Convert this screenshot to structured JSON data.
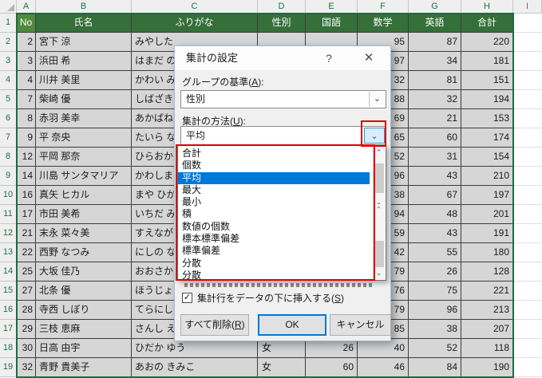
{
  "icons": {
    "help": "?",
    "close": "✕",
    "check": "✓",
    "combo_arrow": "⌄",
    "scroll_up": "⌃",
    "scroll_down": "⌄"
  },
  "colors": {
    "header_green": "#356f39",
    "selection_green": "#1d6b40",
    "annotation_red": "#e10000",
    "selected_item_blue": "#0078d7"
  },
  "spreadsheet": {
    "column_letters": [
      "A",
      "B",
      "C",
      "D",
      "E",
      "F",
      "G",
      "H",
      "I"
    ],
    "header": {
      "row_num": "1",
      "cells": [
        "No",
        "氏名",
        "ふりがな",
        "性別",
        "国語",
        "数学",
        "英語",
        "合計"
      ]
    },
    "rows": [
      {
        "row_num": "2",
        "cells": [
          "2",
          "宮下 涼",
          "みやした",
          "",
          "",
          "95",
          "87",
          "220"
        ]
      },
      {
        "row_num": "3",
        "cells": [
          "3",
          "浜田 希",
          "はまだ の",
          "",
          "",
          "97",
          "34",
          "181"
        ]
      },
      {
        "row_num": "4",
        "cells": [
          "4",
          "川井 美里",
          "かわい み",
          "",
          "",
          "32",
          "81",
          "151"
        ]
      },
      {
        "row_num": "5",
        "cells": [
          "7",
          "柴崎 優",
          "しばざき",
          "",
          "",
          "88",
          "32",
          "194"
        ]
      },
      {
        "row_num": "6",
        "cells": [
          "8",
          "赤羽 美幸",
          "あかばね",
          "",
          "",
          "69",
          "21",
          "153"
        ]
      },
      {
        "row_num": "7",
        "cells": [
          "9",
          "平 奈央",
          "たいら な",
          "",
          "",
          "65",
          "60",
          "174"
        ]
      },
      {
        "row_num": "8",
        "cells": [
          "12",
          "平岡 那奈",
          "ひらおか",
          "",
          "",
          "52",
          "31",
          "154"
        ]
      },
      {
        "row_num": "9",
        "cells": [
          "14",
          "川島 サンタマリア",
          "かわしま",
          "",
          "",
          "96",
          "43",
          "210"
        ]
      },
      {
        "row_num": "10",
        "cells": [
          "16",
          "真矢 ヒカル",
          "まや ひか",
          "",
          "",
          "38",
          "67",
          "197"
        ]
      },
      {
        "row_num": "11",
        "cells": [
          "17",
          "市田 美希",
          "いちだ み",
          "",
          "",
          "94",
          "48",
          "201"
        ]
      },
      {
        "row_num": "12",
        "cells": [
          "21",
          "末永 菜々美",
          "すえなが",
          "",
          "",
          "59",
          "43",
          "191"
        ]
      },
      {
        "row_num": "13",
        "cells": [
          "22",
          "西野 なつみ",
          "にしの な",
          "",
          "",
          "42",
          "55",
          "180"
        ]
      },
      {
        "row_num": "14",
        "cells": [
          "25",
          "大坂 佳乃",
          "おおさか",
          "",
          "",
          "79",
          "26",
          "128"
        ]
      },
      {
        "row_num": "15",
        "cells": [
          "27",
          "北条 優",
          "ほうじょ",
          "",
          "",
          "76",
          "75",
          "221"
        ]
      },
      {
        "row_num": "16",
        "cells": [
          "28",
          "寺西 しぼり",
          "てらにし",
          "",
          "",
          "79",
          "96",
          "213"
        ]
      },
      {
        "row_num": "17",
        "cells": [
          "29",
          "三枝 恵麻",
          "さんし え",
          "",
          "",
          "85",
          "38",
          "207"
        ]
      },
      {
        "row_num": "18",
        "cells": [
          "30",
          "日高 由宇",
          "ひだか ゆう",
          "女",
          "26",
          "40",
          "52",
          "118"
        ]
      },
      {
        "row_num": "19",
        "cells": [
          "32",
          "青野 貴美子",
          "あおの きみこ",
          "女",
          "60",
          "46",
          "84",
          "190"
        ]
      }
    ]
  },
  "dialog": {
    "title": "集計の設定",
    "group_by_label": {
      "pre": "グループの基準(",
      "key": "A",
      "post": "):"
    },
    "group_by_value": "性別",
    "method_label": {
      "pre": "集計の方法(",
      "key": "U",
      "post": "):"
    },
    "method_value": "平均",
    "method_options": [
      "合計",
      "個数",
      "平均",
      "最大",
      "最小",
      "積",
      "数値の個数",
      "標本標準偏差",
      "標準偏差",
      "分散",
      "分散"
    ],
    "selected_option_index": 2,
    "checkbox": {
      "checked": true,
      "label": {
        "pre": "集計行をデータの下に挿入する(",
        "key": "S",
        "post": ")"
      }
    },
    "buttons": {
      "delete_all": {
        "pre": "すべて削除(",
        "key": "R",
        "post": ")"
      },
      "ok": "OK",
      "cancel": "キャンセル"
    }
  }
}
